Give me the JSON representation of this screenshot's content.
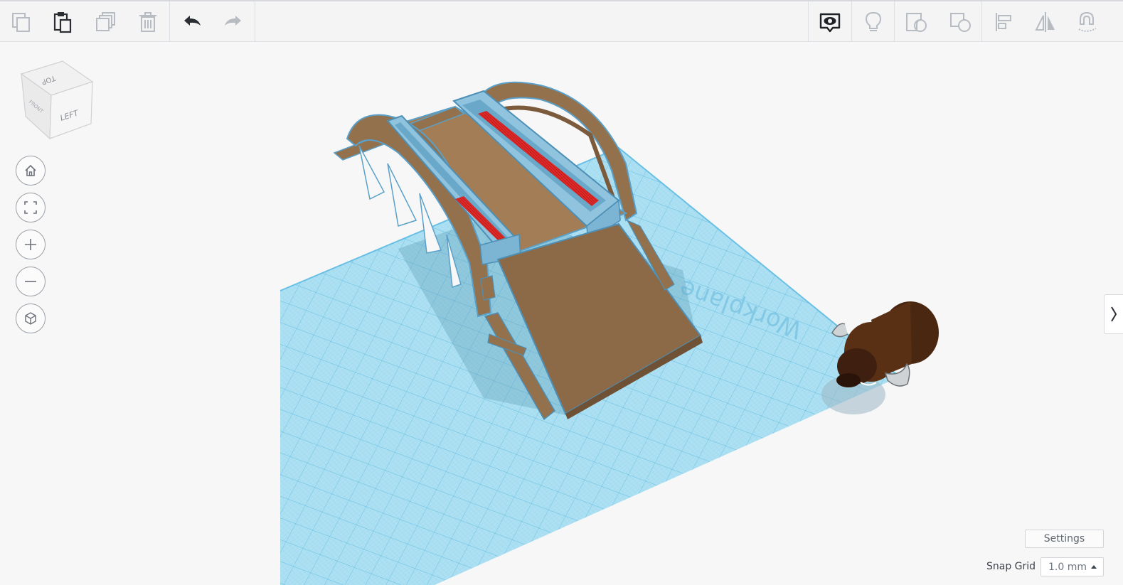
{
  "toolbar": {
    "left_tools": [
      "copy-icon",
      "paste-icon",
      "duplicate-icon",
      "trash-icon",
      "undo-icon",
      "redo-icon"
    ],
    "right_tools": [
      "show-all-icon",
      "note-icon",
      "group-icon",
      "ungroup-icon",
      "align-icon",
      "mirror-icon",
      "magnet-icon"
    ]
  },
  "view_cube": {
    "top_label": "TOP",
    "left_label": "LEFT",
    "front_label": "FRONT"
  },
  "nav_controls": [
    "home-icon",
    "fit-view-icon",
    "zoom-in-icon",
    "zoom-out-icon",
    "perspective-icon"
  ],
  "workplane": {
    "label": "Workplane"
  },
  "settings": {
    "label": "Settings"
  },
  "snap_grid": {
    "label": "Snap Grid",
    "value": "1.0 mm"
  },
  "colors": {
    "workplane": "#a9dcef",
    "grid_line": "#6fc4e6",
    "wood": "#94714d",
    "wood_light": "#a27d55",
    "selected_outline": "#5aa0c8",
    "rail_blue": "#8fc3de",
    "rail_red": "#e02a2a",
    "ox_dark": "#4a2710"
  }
}
